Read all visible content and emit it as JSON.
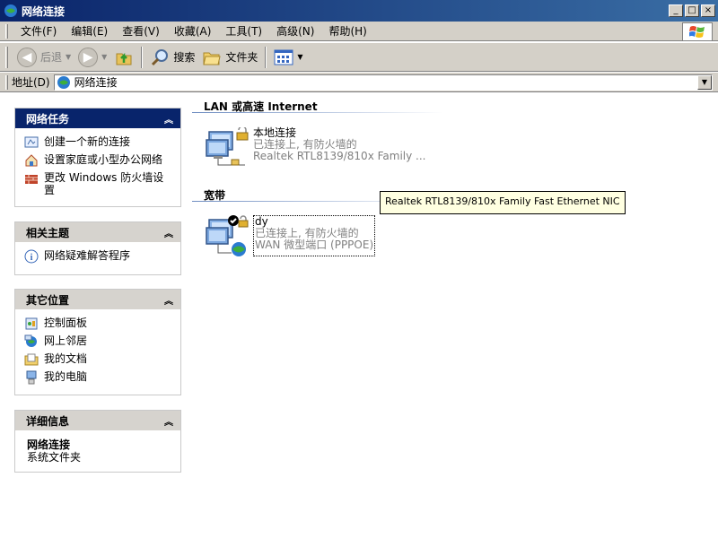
{
  "window": {
    "title": "网络连接",
    "buttons": [
      "_",
      "□",
      "×"
    ]
  },
  "menu": [
    {
      "label": "文件(F)"
    },
    {
      "label": "编辑(E)"
    },
    {
      "label": "查看(V)"
    },
    {
      "label": "收藏(A)"
    },
    {
      "label": "工具(T)"
    },
    {
      "label": "高级(N)"
    },
    {
      "label": "帮助(H)"
    }
  ],
  "toolbar": {
    "back_label": "后退",
    "search_label": "搜索",
    "folders_label": "文件夹"
  },
  "address": {
    "label": "地址(D)",
    "value": "网络连接"
  },
  "left_panes": [
    {
      "title": "网络任务",
      "items": [
        {
          "label": "创建一个新的连接",
          "icon": "new-connection-icon"
        },
        {
          "label": "设置家庭或小型办公网络",
          "icon": "home-network-icon"
        },
        {
          "label": "更改 Windows 防火墙设置",
          "icon": "firewall-icon"
        }
      ]
    },
    {
      "title": "相关主题",
      "items": [
        {
          "label": "网络疑难解答程序",
          "icon": "info-icon"
        }
      ]
    },
    {
      "title": "其它位置",
      "items": [
        {
          "label": "控制面板",
          "icon": "control-panel-icon"
        },
        {
          "label": "网上邻居",
          "icon": "network-places-icon"
        },
        {
          "label": "我的文档",
          "icon": "my-documents-icon"
        },
        {
          "label": "我的电脑",
          "icon": "my-computer-icon"
        }
      ]
    },
    {
      "title": "详细信息",
      "detail_title": "网络连接",
      "detail_sub": "系统文件夹"
    }
  ],
  "groups": [
    {
      "title": "LAN 或高速 Internet",
      "connections": [
        {
          "name": "本地连接",
          "status": "已连接上, 有防火墙的",
          "device": "Realtek RTL8139/810x Family ..."
        }
      ]
    },
    {
      "title": "宽带",
      "connections": [
        {
          "name": "dy",
          "status": "已连接上, 有防火墙的",
          "device": "WAN 微型端口 (PPPOE)"
        }
      ]
    }
  ],
  "tooltip": "Realtek RTL8139/810x Family Fast Ethernet NIC",
  "colors": {
    "pane_header_primary": "#08246b",
    "pane_header": "#d6d3ce",
    "chrome": "#d4d0c8"
  }
}
